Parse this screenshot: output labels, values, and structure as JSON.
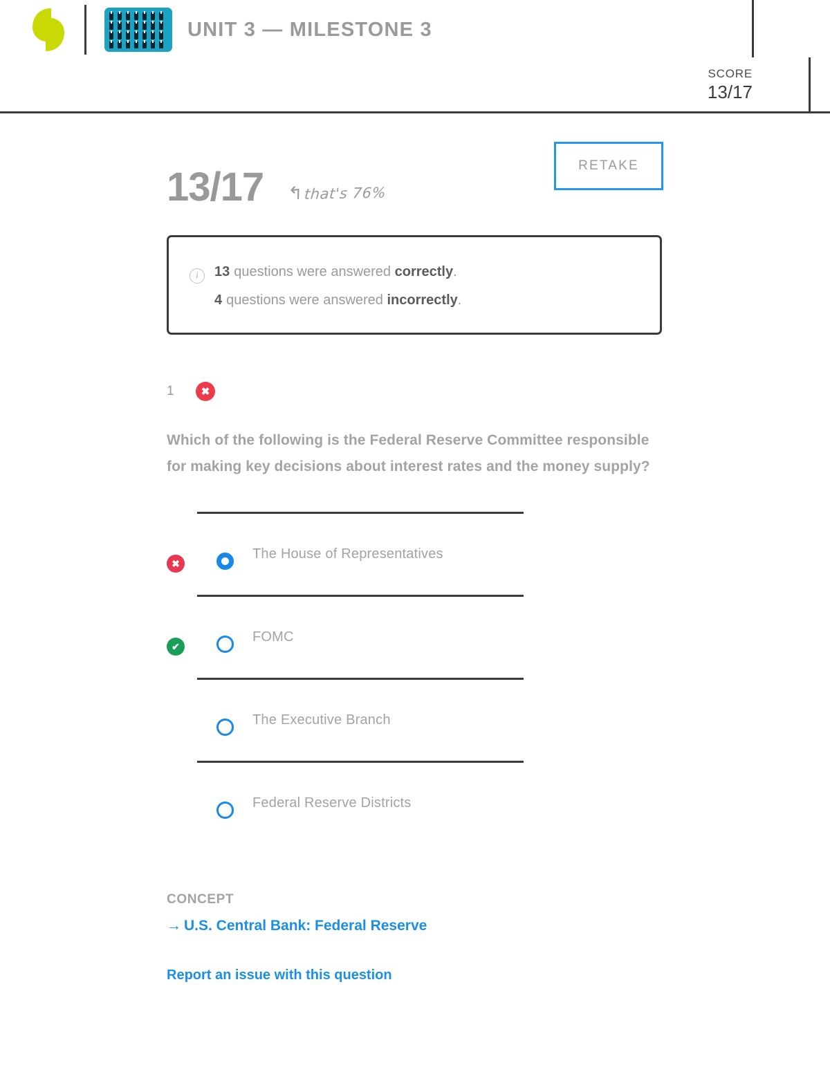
{
  "header": {
    "title": "UNIT 3 — MILESTONE 3",
    "logo_name": "sophia-leaf-logo",
    "unit_icon_name": "people-grid-icon",
    "score_label": "SCORE",
    "score_value": "13/17"
  },
  "summary": {
    "big_score": "13/17",
    "handwritten_note": "that's 76%",
    "handwritten_arrow": "↰",
    "retake_label": "RETAKE",
    "info": {
      "correct_count": "13",
      "correct_text_pre": "questions were answered",
      "correct_text_bold": "correctly",
      "correct_text_post": ".",
      "incorrect_count": "4",
      "incorrect_text_pre": "questions were answered",
      "incorrect_text_bold": "incorrectly",
      "incorrect_text_post": "."
    }
  },
  "question": {
    "number": "1",
    "status": "incorrect",
    "status_glyph": "✖",
    "text": "Which of the following is the Federal Reserve Committee responsible for making key decisions about interest rates and the money supply?",
    "options": [
      {
        "label": "The House of Representatives",
        "mark": "incorrect",
        "mark_glyph": "✖",
        "selected": true
      },
      {
        "label": "FOMC",
        "mark": "correct",
        "mark_glyph": "✔",
        "selected": false
      },
      {
        "label": "The Executive Branch",
        "mark": "none",
        "mark_glyph": "",
        "selected": false
      },
      {
        "label": "Federal Reserve Districts",
        "mark": "none",
        "mark_glyph": "",
        "selected": false
      }
    ],
    "concept_label": "CONCEPT",
    "concept_arrow": "→",
    "concept_link": "U.S. Central Bank: Federal Reserve",
    "report_link": "Report an issue with this question"
  },
  "colors": {
    "brand_green": "#c8d904",
    "unit_icon_blue": "#1da2c4",
    "accent_blue": "#1b8fe5",
    "radio_blue": "#1989e8",
    "incorrect_red": "#e8384f",
    "correct_green": "#1a9d57",
    "text_gray": "#a3a3a3",
    "rule_dark": "#3a3a3a"
  }
}
